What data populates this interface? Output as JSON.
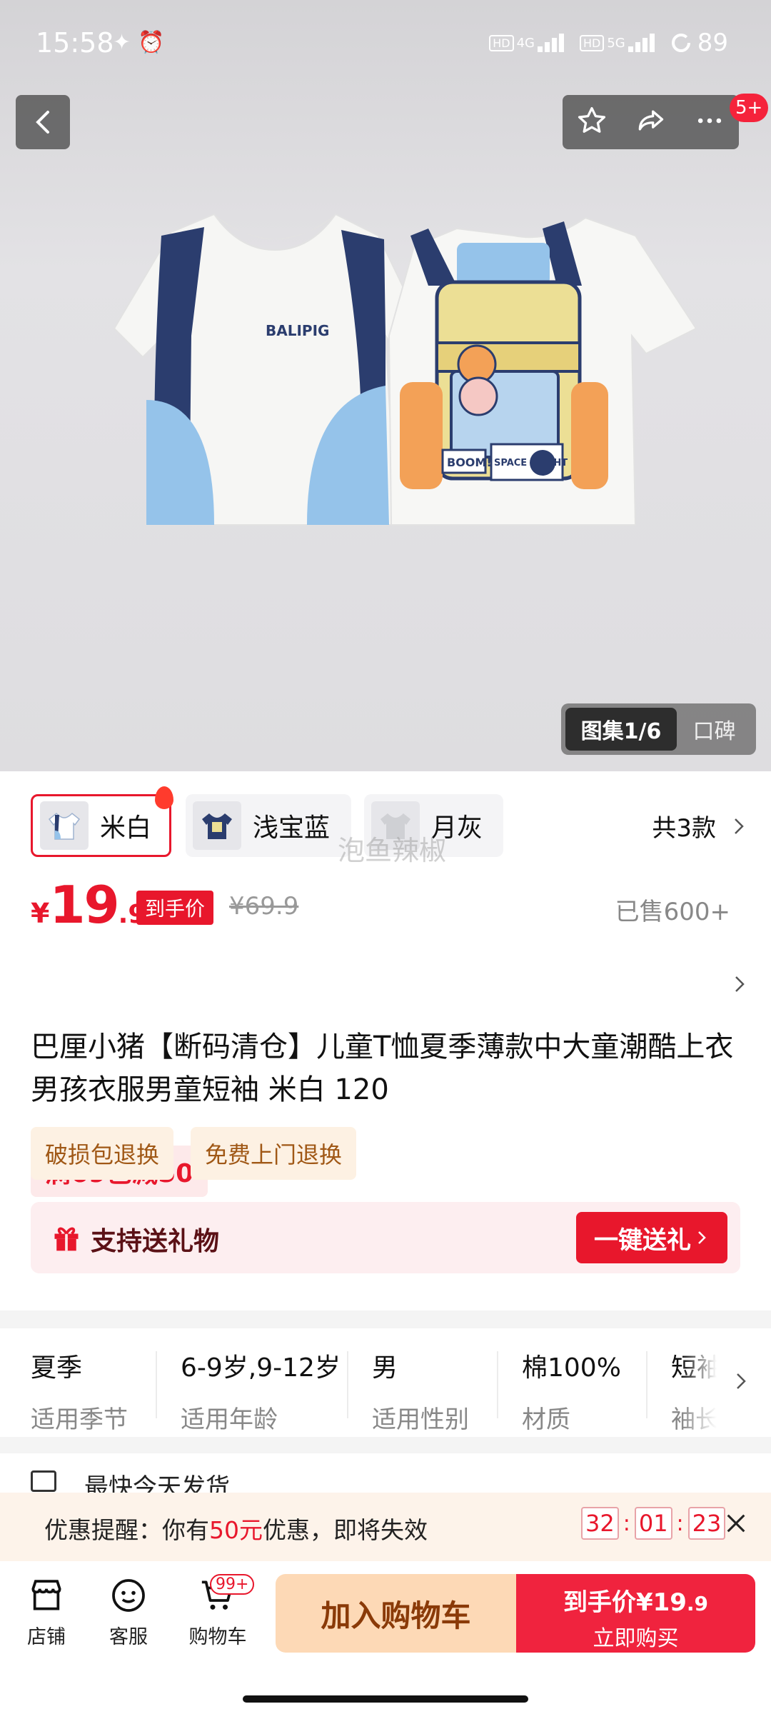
{
  "status_bar": {
    "time": "15:58",
    "net1": "4G",
    "net2": "5G",
    "hd": "HD",
    "battery": "89"
  },
  "top_bar": {
    "badge": "5+"
  },
  "product_image": {
    "print_text_1": "BALIPIG",
    "print_text_2": "BOOM!",
    "print_text_3": "SPACE FLIGHT"
  },
  "gallery": {
    "active_tab": "图集1/6",
    "other_tab": "口碑"
  },
  "colors": {
    "options": [
      {
        "label": "米白",
        "selected": true
      },
      {
        "label": "浅宝蓝",
        "selected": false
      },
      {
        "label": "月灰",
        "selected": false
      }
    ],
    "total": "共3款",
    "watermark": "泡鱼辣椒"
  },
  "price": {
    "currency": "¥",
    "integer": "19",
    "decimal": ".9",
    "tag": "到手价",
    "original": "¥69.9",
    "sold": "已售600+"
  },
  "promo": {
    "text": "满69已减50"
  },
  "product": {
    "title": "巴厘小猪【断码清仓】儿童T恤夏季薄款中大童潮酷上衣男孩衣服男童短袖 米白 120",
    "tags": [
      "破损包退换",
      "免费上门退换"
    ]
  },
  "gift": {
    "label": "支持送礼物",
    "button": "一键送礼"
  },
  "params": [
    {
      "value": "夏季",
      "key": "适用季节"
    },
    {
      "value": "6-9岁,9-12岁",
      "key": "适用年龄"
    },
    {
      "value": "男",
      "key": "适用性别"
    },
    {
      "value": "棉100%",
      "key": "材质"
    },
    {
      "value": "短袖",
      "key": "袖长"
    }
  ],
  "shipping_peek": "最快今天发货",
  "coupon": {
    "prefix": "优惠提醒：你有",
    "amount": "50元",
    "suffix": "优惠，即将失效",
    "countdown": [
      "32",
      "01",
      "23"
    ]
  },
  "bottom": {
    "shop": "店铺",
    "service": "客服",
    "cart": "购物车",
    "cart_badge": "99+",
    "add_cart": "加入购物车",
    "buy_price_label": "到手价",
    "buy_price": "¥19",
    "buy_price_dec": ".9",
    "buy_now": "立即购买"
  },
  "colors_theme": {
    "accent": "#e8172c",
    "add_cart_bg": "#fdd9b6",
    "buy_bg": "#f0233e"
  }
}
